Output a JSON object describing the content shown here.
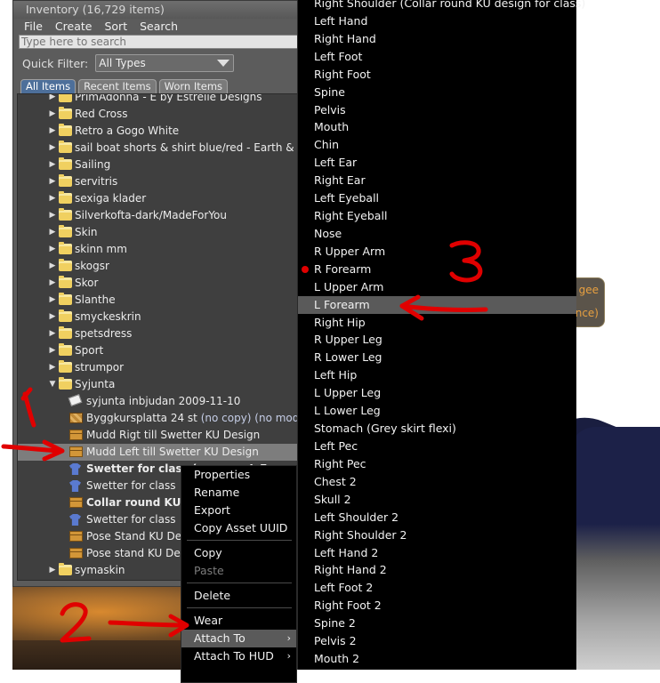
{
  "inventory": {
    "title": "Inventory (16,729 items)",
    "menu": [
      "File",
      "Create",
      "Sort",
      "Search"
    ],
    "search_placeholder": "Type here to search",
    "quick_filter_label": "Quick Filter:",
    "quick_filter_value": "All Types",
    "tabs": [
      "All Items",
      "Recent Items",
      "Worn Items"
    ],
    "tree": [
      {
        "label": "PrimAdonna - E by Estrelle Designs",
        "type": "folder",
        "level": 1,
        "expander": "right"
      },
      {
        "label": "Red Cross",
        "type": "folder",
        "level": 1,
        "expander": "right"
      },
      {
        "label": "Retro a Gogo White",
        "type": "folder",
        "level": 1,
        "expander": "right"
      },
      {
        "label": "sail boat shorts & shirt blue/red - Earth & Sky",
        "type": "folder",
        "level": 1,
        "expander": "right"
      },
      {
        "label": "Sailing",
        "type": "folder",
        "level": 1,
        "expander": "right"
      },
      {
        "label": "servitris",
        "type": "folder",
        "level": 1,
        "expander": "right"
      },
      {
        "label": "sexiga klader",
        "type": "folder",
        "level": 1,
        "expander": "right"
      },
      {
        "label": "Silverkofta-dark/MadeForYou",
        "type": "folder",
        "level": 1,
        "expander": "right"
      },
      {
        "label": "Skin",
        "type": "folder",
        "level": 1,
        "expander": "right"
      },
      {
        "label": "skinn mm",
        "type": "folder",
        "level": 1,
        "expander": "right"
      },
      {
        "label": "skogsr",
        "type": "folder",
        "level": 1,
        "expander": "right"
      },
      {
        "label": "Skor",
        "type": "folder",
        "level": 1,
        "expander": "right"
      },
      {
        "label": "Slanthe",
        "type": "folder",
        "level": 1,
        "expander": "right"
      },
      {
        "label": "smyckeskrin",
        "type": "folder",
        "level": 1,
        "expander": "right"
      },
      {
        "label": "spetsdress",
        "type": "folder",
        "level": 1,
        "expander": "right"
      },
      {
        "label": "Sport",
        "type": "folder",
        "level": 1,
        "expander": "right"
      },
      {
        "label": "strumpor",
        "type": "folder",
        "level": 1,
        "expander": "right"
      },
      {
        "label": "Syjunta",
        "type": "folder",
        "level": 1,
        "expander": "down"
      },
      {
        "label": "syjunta inbjudan 2009-11-10",
        "type": "card",
        "level": 2
      },
      {
        "label": "Byggkursplatta 24 st",
        "suffix": " (no copy) (no modify)",
        "type": "multi",
        "level": 2
      },
      {
        "label": "Mudd  Rigt till Swetter KU Design",
        "type": "box",
        "level": 2
      },
      {
        "label": "Mudd  Left till Swetter KU Design",
        "type": "box",
        "level": 2,
        "selected": true
      },
      {
        "label": "Swetter for class (worn on L Forearm)",
        "type": "shirt",
        "level": 2,
        "bold": true
      },
      {
        "label": "Swetter for class",
        "type": "shirt",
        "level": 2
      },
      {
        "label": "Collar round KU design for class",
        "type": "box",
        "level": 2,
        "bold": true
      },
      {
        "label": "Swetter for class",
        "type": "shirt",
        "level": 2
      },
      {
        "label": "Pose Stand  KU Design",
        "type": "box",
        "level": 2
      },
      {
        "label": "Pose stand KU Design",
        "type": "box",
        "level": 2
      },
      {
        "label": "symaskin",
        "type": "folder",
        "level": 1,
        "expander": "right"
      }
    ]
  },
  "context_menu": {
    "items": [
      {
        "label": "Properties"
      },
      {
        "label": "Rename"
      },
      {
        "label": "Export"
      },
      {
        "label": "Copy Asset UUID"
      },
      {
        "separator": true
      },
      {
        "label": "Copy"
      },
      {
        "label": "Paste",
        "disabled": true
      },
      {
        "separator": true
      },
      {
        "label": "Delete"
      },
      {
        "separator": true
      },
      {
        "label": "Wear"
      },
      {
        "label": "Attach To",
        "submenu": true,
        "highlighted": true
      },
      {
        "label": "Attach To HUD",
        "submenu": true
      }
    ],
    "submenu_arrow": "›"
  },
  "attach_submenu": {
    "items": [
      {
        "label": "Right Shoulder (Collar round KU design  for class)"
      },
      {
        "label": "Left Hand"
      },
      {
        "label": "Right Hand"
      },
      {
        "label": "Left Foot"
      },
      {
        "label": "Right Foot"
      },
      {
        "label": "Spine"
      },
      {
        "label": "Pelvis"
      },
      {
        "label": "Mouth"
      },
      {
        "label": "Chin"
      },
      {
        "label": "Left Ear"
      },
      {
        "label": "Right Ear"
      },
      {
        "label": "Left Eyeball"
      },
      {
        "label": "Right Eyeball"
      },
      {
        "label": "Nose"
      },
      {
        "label": "R Upper Arm"
      },
      {
        "label": "R Forearm",
        "occupied": true
      },
      {
        "label": "L Upper Arm"
      },
      {
        "label": "L Forearm",
        "highlighted": true
      },
      {
        "label": "Right Hip"
      },
      {
        "label": "R Upper Leg"
      },
      {
        "label": "R Lower Leg"
      },
      {
        "label": "Left Hip"
      },
      {
        "label": "L Upper Leg"
      },
      {
        "label": "L Lower Leg"
      },
      {
        "label": "Stomach (Grey skirt flexi)"
      },
      {
        "label": "Left Pec"
      },
      {
        "label": "Right Pec"
      },
      {
        "label": "Chest 2"
      },
      {
        "label": "Skull 2"
      },
      {
        "label": "Left Shoulder 2"
      },
      {
        "label": "Right Shoulder 2"
      },
      {
        "label": "Left Hand 2"
      },
      {
        "label": "Right Hand 2"
      },
      {
        "label": "Left Foot 2"
      },
      {
        "label": "Right Foot 2"
      },
      {
        "label": "Spine 2"
      },
      {
        "label": "Pelvis 2"
      },
      {
        "label": "Mouth 2"
      }
    ]
  },
  "scene_popup": {
    "line1": "gee",
    "line2": "nce)"
  },
  "annotations": {
    "step1": "1",
    "step2": "2",
    "step3": "3",
    "color": "#e00000"
  }
}
